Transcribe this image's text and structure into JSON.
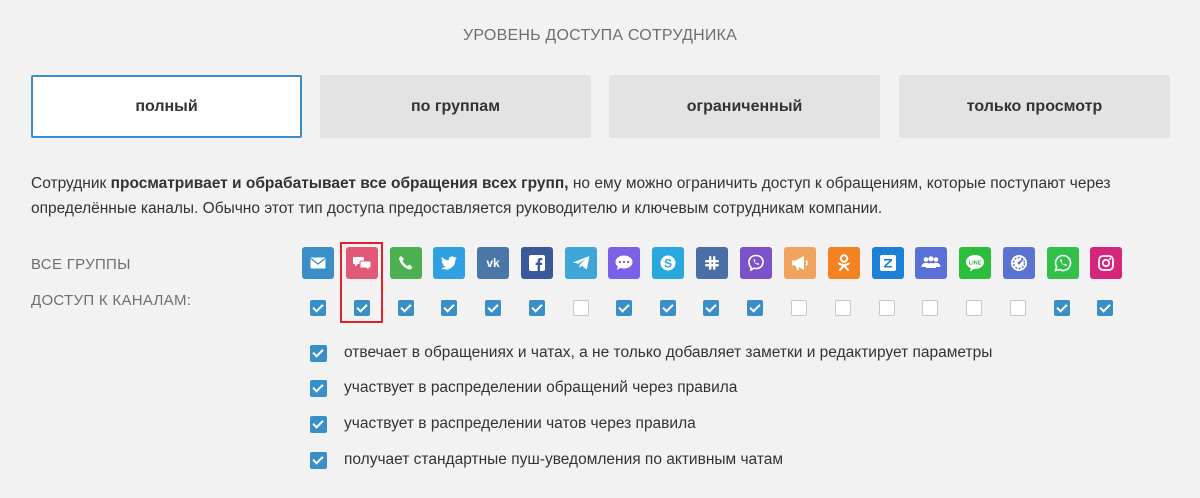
{
  "title": "УРОВЕНЬ ДОСТУПА СОТРУДНИКА",
  "tabs": [
    {
      "label": "полный",
      "active": true
    },
    {
      "label": "по группам",
      "active": false
    },
    {
      "label": "ограниченный",
      "active": false
    },
    {
      "label": "только просмотр",
      "active": false
    }
  ],
  "description": {
    "prefix": "Сотрудник ",
    "bold": "просматривает и обрабатывает все обращения всех групп,",
    "suffix": " но ему можно ограничить доступ к обращениям, которые поступают через определённые каналы. Обычно этот тип доступа предоставляется руководителю и ключевым сотрудникам компании."
  },
  "labels": {
    "all_groups": "ВСЕ ГРУППЫ",
    "channel_access": "ДОСТУП К КАНАЛАМ:"
  },
  "channels": [
    {
      "name": "email-icon",
      "color": "#3b8fc9",
      "checked": true
    },
    {
      "name": "chat-icon",
      "color": "#e05a78",
      "checked": true
    },
    {
      "name": "phone-icon",
      "color": "#4caf50",
      "checked": true
    },
    {
      "name": "twitter-icon",
      "color": "#2fa0e0",
      "checked": true
    },
    {
      "name": "vk-icon",
      "color": "#4a76a8",
      "checked": true
    },
    {
      "name": "facebook-icon",
      "color": "#3b5998",
      "checked": true
    },
    {
      "name": "telegram-icon",
      "color": "#3ea6d8",
      "checked": false
    },
    {
      "name": "messenger-icon",
      "color": "#7b61e8",
      "checked": true
    },
    {
      "name": "skype-icon",
      "color": "#29a8e0",
      "checked": true
    },
    {
      "name": "slack-icon",
      "color": "#4a6fa5",
      "checked": true
    },
    {
      "name": "viber-icon",
      "color": "#7b52c9",
      "checked": true
    },
    {
      "name": "megaphone-icon",
      "color": "#f0a35a",
      "checked": false
    },
    {
      "name": "odnoklassniki-icon",
      "color": "#f58220",
      "checked": false
    },
    {
      "name": "zendesk-icon",
      "color": "#1e7fd6",
      "checked": false
    },
    {
      "name": "group-icon",
      "color": "#5b6fd8",
      "checked": false
    },
    {
      "name": "line-icon",
      "color": "#2bbd3c",
      "checked": false
    },
    {
      "name": "gauge-icon",
      "color": "#5b73d0",
      "checked": false
    },
    {
      "name": "whatsapp-icon",
      "color": "#31c04a",
      "checked": true
    },
    {
      "name": "instagram-icon",
      "color": "#d6267c",
      "checked": true
    }
  ],
  "options": [
    {
      "label": "отвечает в обращениях и чатах, а не только добавляет заметки и редактирует параметры",
      "checked": true
    },
    {
      "label": "участвует в распределении обращений через правила",
      "checked": true
    },
    {
      "label": "участвует в распределении чатов через правила",
      "checked": true
    },
    {
      "label": "получает стандартные пуш-уведомления по активным чатам",
      "checked": true
    }
  ]
}
